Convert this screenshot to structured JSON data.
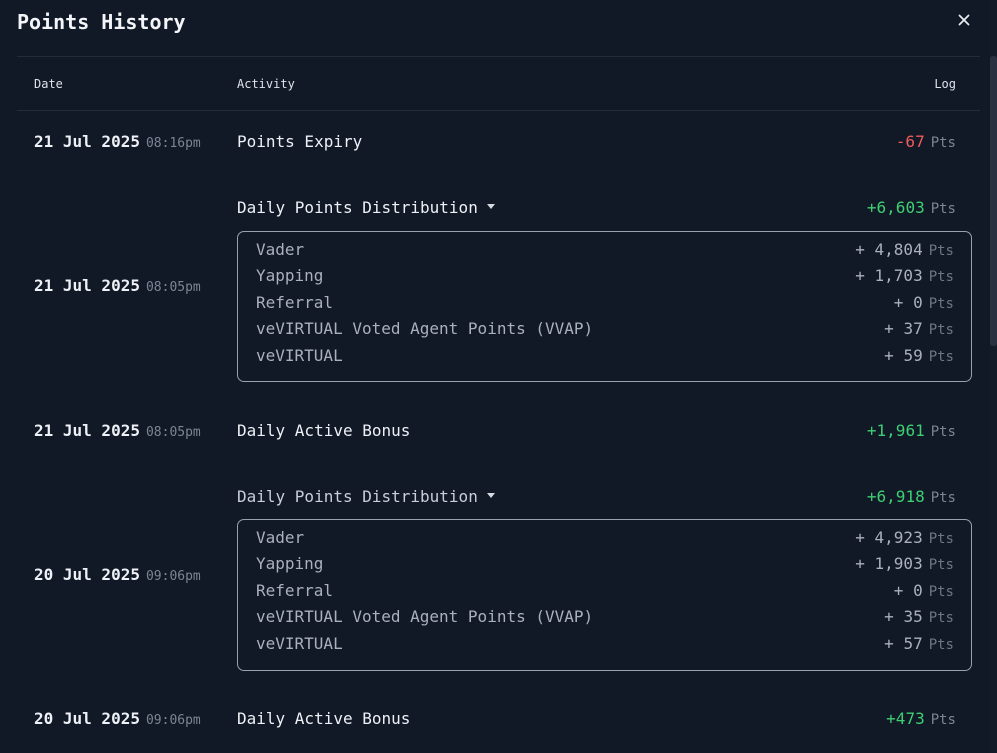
{
  "title": "Points History",
  "columns": {
    "date": "Date",
    "activity": "Activity",
    "log": "Log"
  },
  "unit": "Pts",
  "entries": [
    {
      "date": "21 Jul 2025",
      "time": "08:16pm",
      "activity": "Points Expiry",
      "amount": "-67",
      "sign": "negative"
    },
    {
      "date": "21 Jul 2025",
      "time": "08:05pm",
      "activity": "Daily Points Distribution",
      "amount": "+6,603",
      "sign": "positive",
      "expanded": true,
      "breakdown": [
        {
          "label": "Vader",
          "amount": "+ 4,804"
        },
        {
          "label": "Yapping",
          "amount": "+ 1,703"
        },
        {
          "label": "Referral",
          "amount": "+ 0"
        },
        {
          "label": "veVIRTUAL Voted Agent Points (VVAP)",
          "amount": "+ 37"
        },
        {
          "label": "veVIRTUAL",
          "amount": "+ 59"
        }
      ]
    },
    {
      "date": "21 Jul 2025",
      "time": "08:05pm",
      "activity": "Daily Active Bonus",
      "amount": "+1,961",
      "sign": "positive"
    },
    {
      "date": "20 Jul 2025",
      "time": "09:06pm",
      "activity": "Daily Points Distribution",
      "amount": "+6,918",
      "sign": "positive",
      "expanded": true,
      "breakdown": [
        {
          "label": "Vader",
          "amount": "+ 4,923"
        },
        {
          "label": "Yapping",
          "amount": "+ 1,903"
        },
        {
          "label": "Referral",
          "amount": "+ 0"
        },
        {
          "label": "veVIRTUAL Voted Agent Points (VVAP)",
          "amount": "+ 35"
        },
        {
          "label": "veVIRTUAL",
          "amount": "+ 57"
        }
      ]
    },
    {
      "date": "20 Jul 2025",
      "time": "09:06pm",
      "activity": "Daily Active Bonus",
      "amount": "+473",
      "sign": "positive"
    }
  ],
  "icons": {
    "close": "close-icon",
    "expand": "caret-down-icon"
  },
  "colors": {
    "background": "#111826",
    "negative": "#f05a5a",
    "positive": "#3ecf73",
    "border": "#9aa1ad"
  }
}
